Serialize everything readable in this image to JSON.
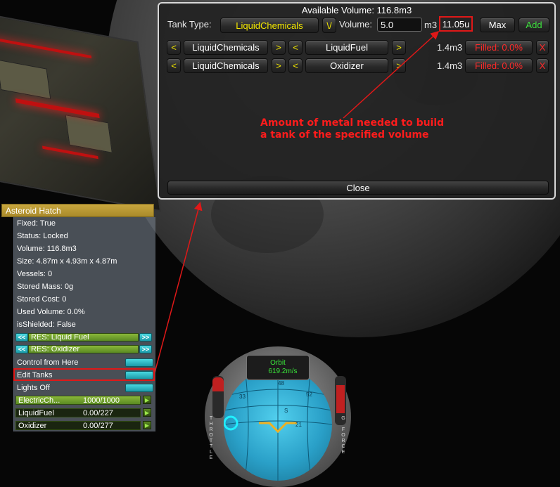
{
  "tank_window": {
    "title": "Available Volume: 116.8m3",
    "tank_type_label": "Tank Type:",
    "tank_type_value": "LiquidChemicals",
    "tank_type_dropdown": "\\/",
    "volume_label": "Volume:",
    "volume_value": "5.0",
    "volume_unit": "m3",
    "metal_amount": "11.05u",
    "max_label": "Max",
    "add_label": "Add",
    "prev_glyph": "<",
    "next_glyph": ">",
    "remove_glyph": "X",
    "tanks": [
      {
        "tank_type": "LiquidChemicals",
        "resource": "LiquidFuel",
        "volume": "1.4m3",
        "filled": "Filled: 0.0%"
      },
      {
        "tank_type": "LiquidChemicals",
        "resource": "Oxidizer",
        "volume": "1.4m3",
        "filled": "Filled: 0.0%"
      }
    ],
    "close_label": "Close"
  },
  "annotation": {
    "line1": "Amount of metal needed to build",
    "line2": "a tank of the specified volume",
    "color": "#ff1c1c"
  },
  "part_window": {
    "title": "Asteroid Hatch",
    "fields": [
      "Fixed: True",
      "Status: Locked",
      "Volume: 116.8m3",
      "Size: 4.87m x 4.93m x 4.87m",
      "Vessels: 0",
      "Stored Mass: 0g",
      "Stored Cost: 0",
      "Used Volume: 0.0%",
      "isShielded: False"
    ],
    "resources": [
      {
        "label": "RES: Liquid Fuel",
        "left": "<<",
        "right": ">>"
      },
      {
        "label": "RES: Oxidizer",
        "left": "<<",
        "right": ">>"
      }
    ],
    "actions": [
      "Control from Here",
      "Edit Tanks",
      "Lights Off"
    ],
    "gauges": [
      {
        "name": "ElectricCh...",
        "value": "1000/1000",
        "fraction": 1.0
      },
      {
        "name": "LiquidFuel",
        "value": "0.00/227",
        "fraction": 0.0
      },
      {
        "name": "Oxidizer",
        "value": "0.00/277",
        "fraction": 0.0
      }
    ],
    "play_glyph": "▶"
  },
  "navball": {
    "mode": "Orbit",
    "speed": "619.2m/s",
    "throttle_label": "THROTTLE",
    "gforce_label": "G FORCE",
    "heading_ticks": [
      "48",
      "52",
      "33",
      "S",
      "21"
    ]
  }
}
